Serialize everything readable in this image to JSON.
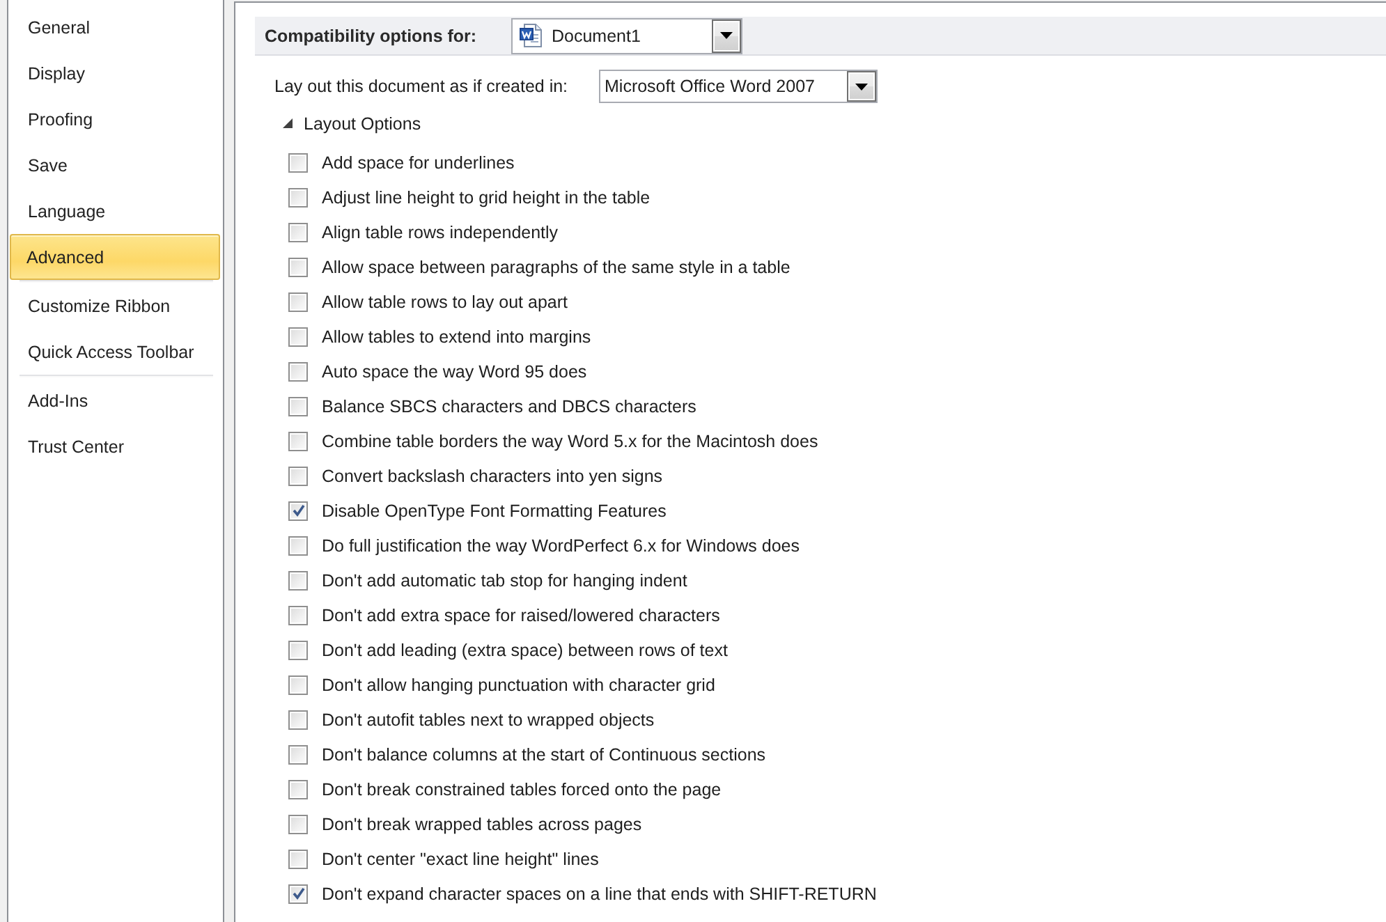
{
  "sidebar": {
    "groups": [
      {
        "items": [
          {
            "label": "General",
            "selected": false
          },
          {
            "label": "Display",
            "selected": false
          },
          {
            "label": "Proofing",
            "selected": false
          },
          {
            "label": "Save",
            "selected": false
          },
          {
            "label": "Language",
            "selected": false
          },
          {
            "label": "Advanced",
            "selected": true
          }
        ]
      },
      {
        "items": [
          {
            "label": "Customize Ribbon",
            "selected": false
          },
          {
            "label": "Quick Access Toolbar",
            "selected": false
          }
        ]
      },
      {
        "items": [
          {
            "label": "Add-Ins",
            "selected": false
          },
          {
            "label": "Trust Center",
            "selected": false
          }
        ]
      }
    ]
  },
  "compatibility": {
    "label": "Compatibility options for:",
    "document": "Document1"
  },
  "layout_as": {
    "label": "Lay out this document as if created in:",
    "value": "Microsoft Office Word 2007"
  },
  "layout_options": {
    "title": "Layout Options",
    "expanded": true,
    "options": [
      {
        "label": "Add space for underlines",
        "checked": false
      },
      {
        "label": "Adjust line height to grid height in the table",
        "checked": false
      },
      {
        "label": "Align table rows independently",
        "checked": false
      },
      {
        "label": "Allow space between paragraphs of the same style in a table",
        "checked": false
      },
      {
        "label": "Allow table rows to lay out apart",
        "checked": false
      },
      {
        "label": "Allow tables to extend into margins",
        "checked": false
      },
      {
        "label": "Auto space the way Word 95 does",
        "checked": false
      },
      {
        "label": "Balance SBCS characters and DBCS characters",
        "checked": false
      },
      {
        "label": "Combine table borders the way Word 5.x for the Macintosh does",
        "checked": false
      },
      {
        "label": "Convert backslash characters into yen signs",
        "checked": false
      },
      {
        "label": "Disable OpenType Font Formatting Features",
        "checked": true
      },
      {
        "label": "Do full justification the way WordPerfect 6.x for Windows does",
        "checked": false
      },
      {
        "label": "Don't add automatic tab stop for hanging indent",
        "checked": false
      },
      {
        "label": "Don't add extra space for raised/lowered characters",
        "checked": false
      },
      {
        "label": "Don't add leading (extra space) between rows of text",
        "checked": false
      },
      {
        "label": "Don't allow hanging punctuation with character grid",
        "checked": false
      },
      {
        "label": "Don't autofit tables next to wrapped objects",
        "checked": false
      },
      {
        "label": "Don't balance columns at the start of Continuous sections",
        "checked": false
      },
      {
        "label": "Don't break constrained tables forced onto the page",
        "checked": false
      },
      {
        "label": "Don't break wrapped tables across pages",
        "checked": false
      },
      {
        "label": "Don't center \"exact line height\" lines",
        "checked": false
      },
      {
        "label": "Don't expand character spaces on a line that ends with SHIFT-RETURN",
        "checked": true
      }
    ]
  }
}
